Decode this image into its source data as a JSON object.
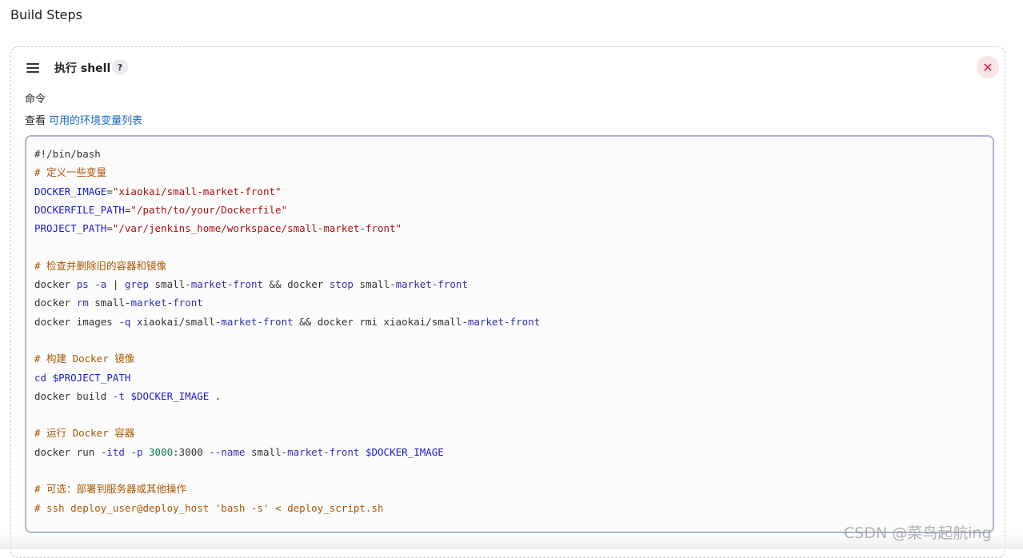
{
  "section": {
    "title": "Build Steps"
  },
  "step": {
    "title": "执行 shell",
    "help_label": "?",
    "close_label": "✕",
    "field_label": "命令",
    "env_prefix": "查看 ",
    "env_link": "可用的环境变量列表"
  },
  "code": {
    "lines": [
      [
        {
          "t": "plain",
          "v": "#!/bin/bash"
        }
      ],
      [
        {
          "t": "comment",
          "v": "# 定义一些变量"
        }
      ],
      [
        {
          "t": "var",
          "v": "DOCKER_IMAGE"
        },
        {
          "t": "plain",
          "v": "="
        },
        {
          "t": "str",
          "v": "\"xiaokai/small-market-front\""
        }
      ],
      [
        {
          "t": "var",
          "v": "DOCKERFILE_PATH"
        },
        {
          "t": "plain",
          "v": "="
        },
        {
          "t": "str",
          "v": "\"/path/to/your/Dockerfile\""
        }
      ],
      [
        {
          "t": "var",
          "v": "PROJECT_PATH"
        },
        {
          "t": "plain",
          "v": "="
        },
        {
          "t": "str",
          "v": "\"/var/jenkins_home/workspace/small-market-front\""
        }
      ],
      [],
      [
        {
          "t": "comment",
          "v": "# 检查并删除旧的容器和镜像"
        }
      ],
      [
        {
          "t": "plain",
          "v": "docker "
        },
        {
          "t": "kw",
          "v": "ps"
        },
        {
          "t": "plain",
          "v": " "
        },
        {
          "t": "kw",
          "v": "-a"
        },
        {
          "t": "plain",
          "v": " | "
        },
        {
          "t": "kw",
          "v": "grep"
        },
        {
          "t": "plain",
          "v": " small-"
        },
        {
          "t": "kw",
          "v": "market-front"
        },
        {
          "t": "plain",
          "v": " && docker "
        },
        {
          "t": "kw",
          "v": "stop"
        },
        {
          "t": "plain",
          "v": " small-"
        },
        {
          "t": "kw",
          "v": "market-front"
        }
      ],
      [
        {
          "t": "plain",
          "v": "docker "
        },
        {
          "t": "kw",
          "v": "rm"
        },
        {
          "t": "plain",
          "v": " small-"
        },
        {
          "t": "kw",
          "v": "market-front"
        }
      ],
      [
        {
          "t": "plain",
          "v": "docker images "
        },
        {
          "t": "kw",
          "v": "-q"
        },
        {
          "t": "plain",
          "v": " xiaokai/small-"
        },
        {
          "t": "kw",
          "v": "market-front"
        },
        {
          "t": "plain",
          "v": " && docker rmi xiaokai/small-"
        },
        {
          "t": "kw",
          "v": "market-front"
        }
      ],
      [],
      [
        {
          "t": "comment",
          "v": "# 构建 Docker 镜像"
        }
      ],
      [
        {
          "t": "kw",
          "v": "cd"
        },
        {
          "t": "plain",
          "v": " "
        },
        {
          "t": "var",
          "v": "$PROJECT_PATH"
        }
      ],
      [
        {
          "t": "plain",
          "v": "docker build "
        },
        {
          "t": "kw",
          "v": "-t"
        },
        {
          "t": "plain",
          "v": " "
        },
        {
          "t": "var",
          "v": "$DOCKER_IMAGE"
        },
        {
          "t": "plain",
          "v": " ."
        }
      ],
      [],
      [
        {
          "t": "comment",
          "v": "# 运行 Docker 容器"
        }
      ],
      [
        {
          "t": "plain",
          "v": "docker run "
        },
        {
          "t": "kw",
          "v": "-itd"
        },
        {
          "t": "plain",
          "v": " "
        },
        {
          "t": "kw",
          "v": "-p"
        },
        {
          "t": "plain",
          "v": " "
        },
        {
          "t": "num",
          "v": "3000"
        },
        {
          "t": "plain",
          "v": ":3000 "
        },
        {
          "t": "kw",
          "v": "--name"
        },
        {
          "t": "plain",
          "v": " small-"
        },
        {
          "t": "kw",
          "v": "market-front"
        },
        {
          "t": "plain",
          "v": " "
        },
        {
          "t": "var",
          "v": "$DOCKER_IMAGE"
        }
      ],
      [],
      [
        {
          "t": "comment",
          "v": "# 可选：部署到服务器或其他操作"
        }
      ],
      [
        {
          "t": "comment",
          "v": "# ssh deploy_user@deploy_host 'bash -s' < deploy_script.sh"
        }
      ]
    ]
  },
  "watermark": "CSDN @菜鸟起航ing"
}
